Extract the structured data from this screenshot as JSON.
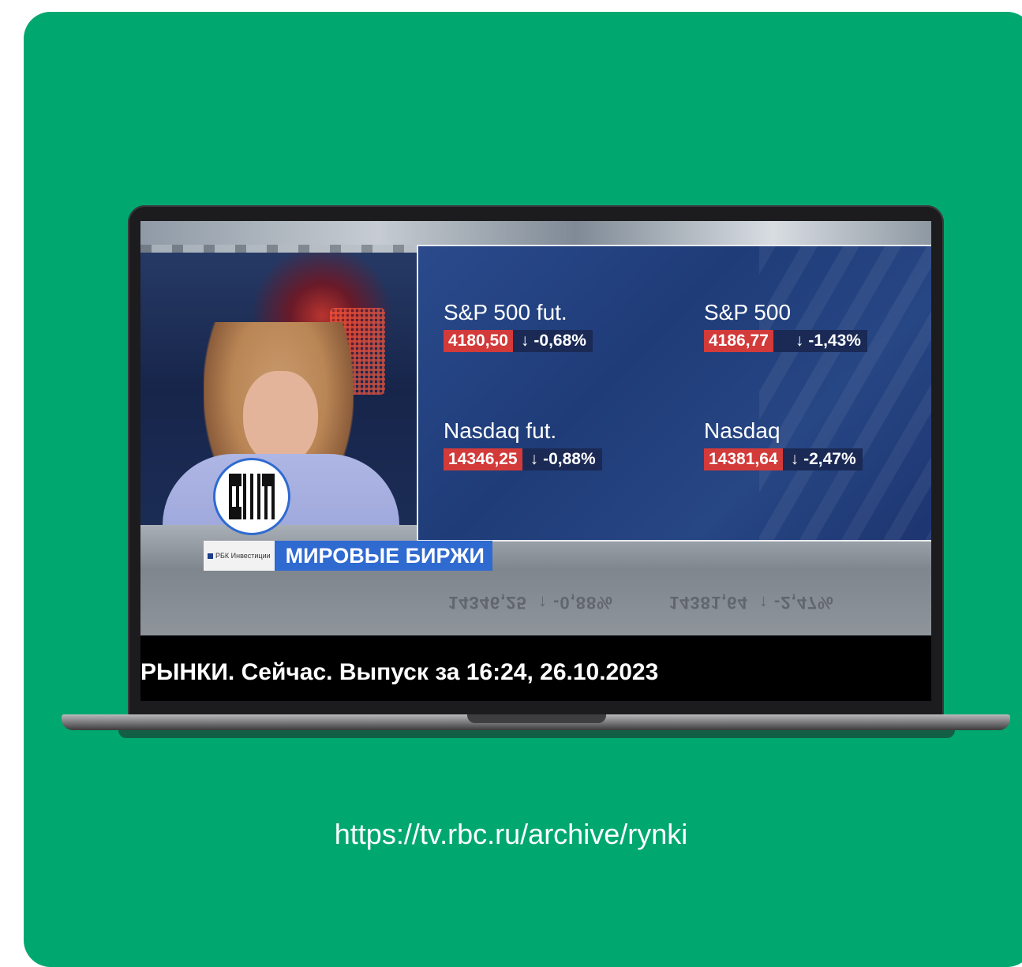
{
  "video": {
    "indices": [
      {
        "name": "S&P 500 fut.",
        "value": "4180,50",
        "change": "-0,68%",
        "direction": "down"
      },
      {
        "name": "S&P 500",
        "value": "4186,77",
        "change": "-1,43%",
        "direction": "down"
      },
      {
        "name": "Nasdaq fut.",
        "value": "14346,25",
        "change": "-0,88%",
        "direction": "down"
      },
      {
        "name": "Nasdaq",
        "value": "14381,64",
        "change": "-2,47%",
        "direction": "down"
      }
    ],
    "arrow_glyph": "↓",
    "brand_label": "РБК Инвестиции",
    "strap_title": "МИРОВЫЕ БИРЖИ",
    "reflection_text": "14346,25  ↑ -0,88%          14381,64  ↑ -2,47%",
    "caption": "РЫНКИ. Сейчас. Выпуск за 16:24, 26.10.2023"
  },
  "url": "https://tv.rbc.ru/archive/rynki",
  "colors": {
    "background": "#00a870",
    "value_badge": "#d33a3a",
    "strap": "#2f6ad0"
  }
}
